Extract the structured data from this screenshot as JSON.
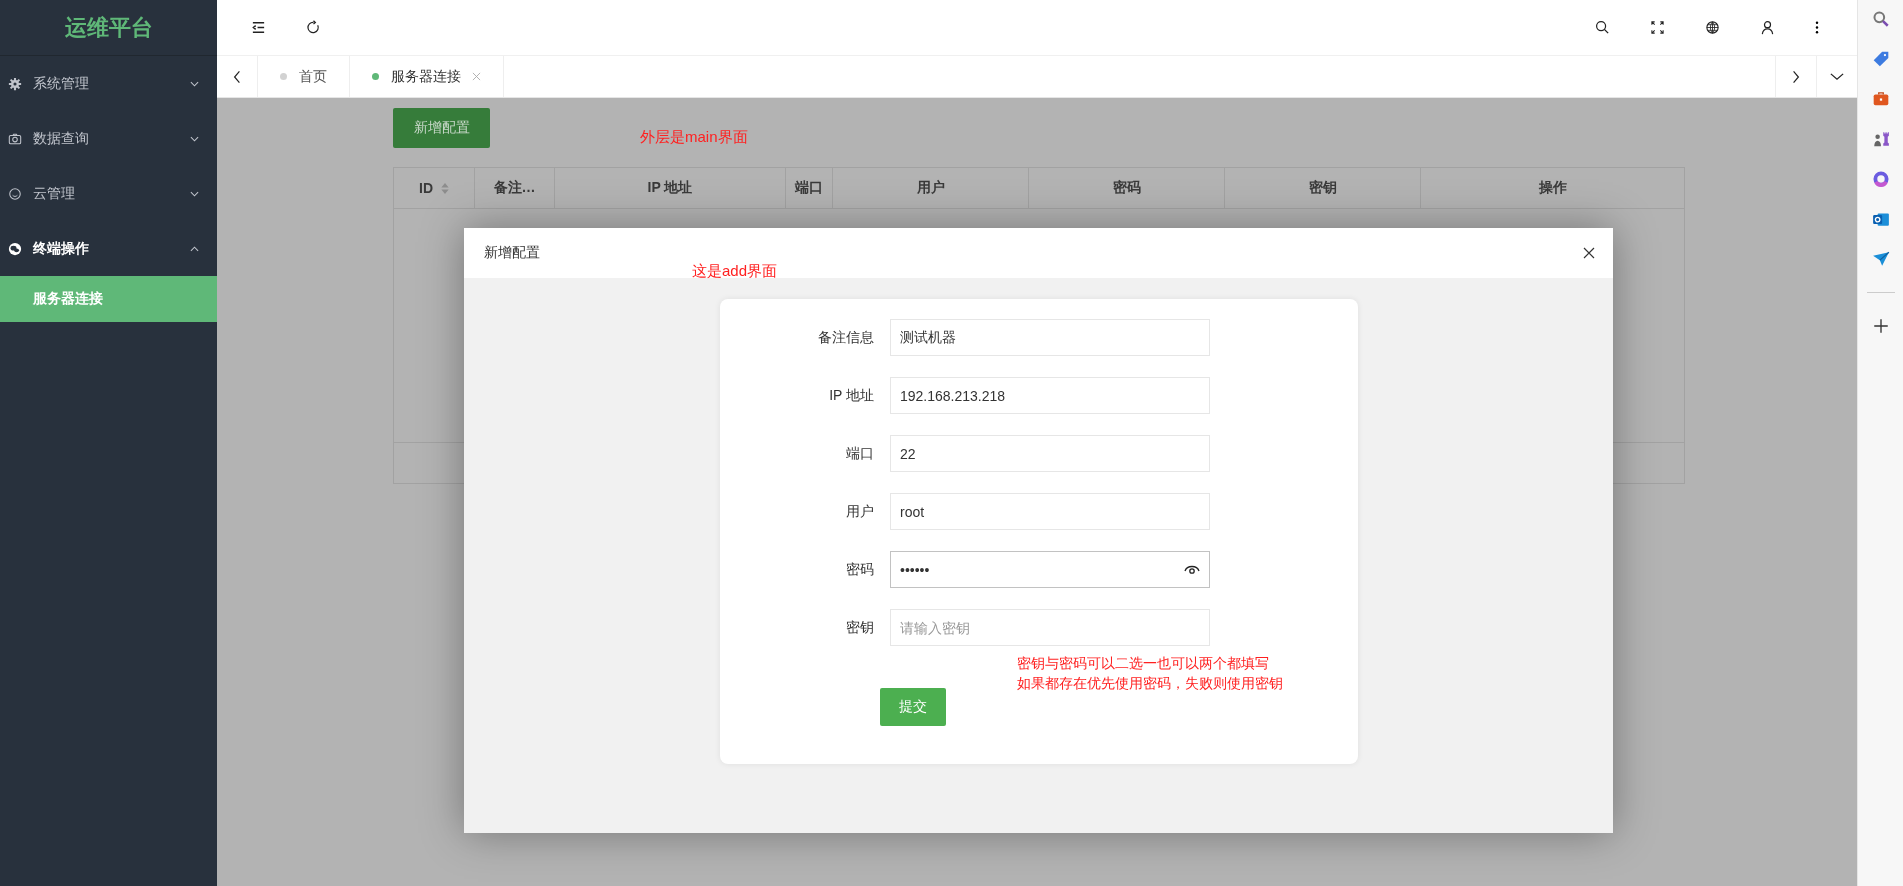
{
  "sidebar": {
    "logo": "运维平台",
    "menu": [
      {
        "label": "系统管理",
        "expanded": false
      },
      {
        "label": "数据查询",
        "expanded": false
      },
      {
        "label": "云管理",
        "expanded": false
      },
      {
        "label": "终端操作",
        "expanded": true,
        "children": [
          {
            "label": "服务器连接",
            "selected": true
          }
        ]
      }
    ]
  },
  "tabs": [
    {
      "label": "首页",
      "selected": false
    },
    {
      "label": "服务器连接",
      "selected": true
    }
  ],
  "main": {
    "add_button": "新增配置",
    "annotation": "外层是main界面",
    "table": {
      "columns": [
        {
          "label": "ID"
        },
        {
          "label": "备注…"
        },
        {
          "label": "IP 地址"
        },
        {
          "label": "端口"
        },
        {
          "label": "用户"
        },
        {
          "label": "密码"
        },
        {
          "label": "密钥"
        },
        {
          "label": "操作"
        }
      ]
    }
  },
  "modal": {
    "title": "新增配置",
    "annotation": "这是add界面",
    "fields": [
      {
        "label": "备注信息",
        "kind": "text",
        "value": "测试机器",
        "focused": false
      },
      {
        "label": "IP 地址",
        "kind": "text",
        "value": "192.168.213.218",
        "focused": false
      },
      {
        "label": "端口",
        "kind": "text",
        "value": "22",
        "focused": false
      },
      {
        "label": "用户",
        "kind": "text",
        "value": "root",
        "focused": false
      },
      {
        "label": "密码",
        "kind": "password",
        "value": "••••••",
        "focused": true
      },
      {
        "label": "密钥",
        "kind": "text",
        "placeholder": "请输入密钥",
        "focused": false
      }
    ],
    "submit": "提交",
    "hint_lines": [
      "密钥与密码可以二选一也可以两个都填写",
      "如果都存在优先使用密码，失败则使用密钥"
    ]
  }
}
